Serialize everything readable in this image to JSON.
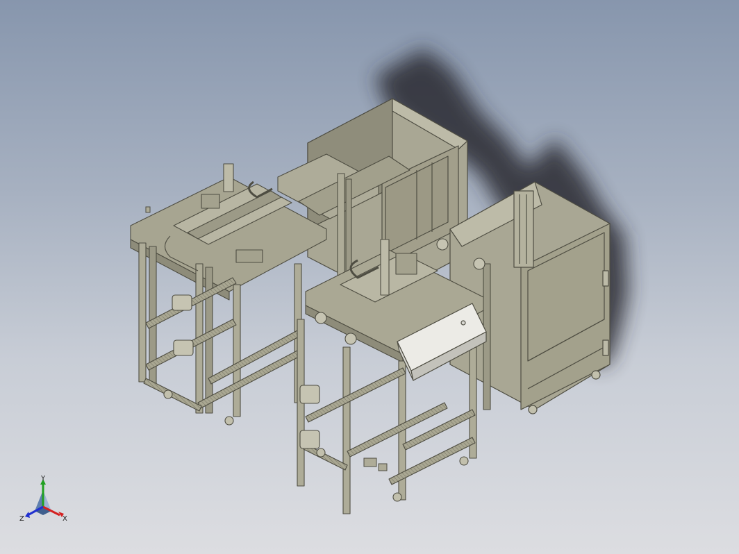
{
  "viewport": {
    "background_top": "#8796ad",
    "background_bottom": "#dcdde1"
  },
  "model": {
    "body_color": "#a6a48f",
    "edge_color": "#4e4d42",
    "shadow_color": "#2a2c33",
    "panel_color": "#ecebe6"
  },
  "triad": {
    "x_label": "X",
    "y_label": "Y",
    "z_label": "Z",
    "x_color": "#d42020",
    "y_color": "#20a020",
    "z_color": "#2030d0"
  }
}
